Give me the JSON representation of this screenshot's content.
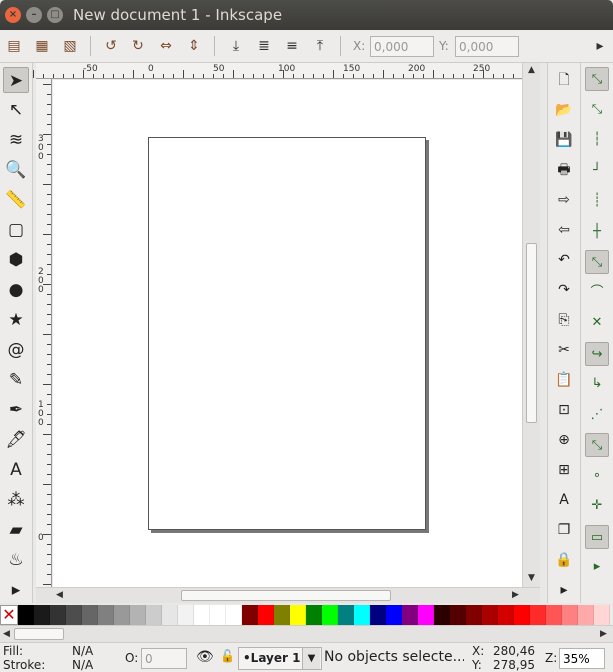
{
  "window": {
    "title": "New document 1 - Inkscape",
    "close_glyph": "×",
    "min_glyph": "–",
    "max_glyph": "□"
  },
  "ctrlbar": {
    "icons": [
      "select-all-icon",
      "select-all-layers-icon",
      "deselect-icon",
      "rotate-ccw-icon",
      "rotate-cw-icon",
      "flip-horizontal-icon",
      "flip-vertical-icon",
      "lower-bottom-icon",
      "lower-icon",
      "raise-icon",
      "raise-top-icon"
    ],
    "x_label": "X:",
    "x_value": "0,000",
    "y_label": "Y:",
    "y_value": "0,000",
    "more": "▸"
  },
  "tools": [
    {
      "name": "selector-tool-icon",
      "glyph": "➤"
    },
    {
      "name": "node-tool-icon",
      "glyph": "↖"
    },
    {
      "name": "tweak-tool-icon",
      "glyph": "≋"
    },
    {
      "name": "zoom-tool-icon",
      "glyph": "🔍"
    },
    {
      "name": "measure-tool-icon",
      "glyph": "📏"
    },
    {
      "name": "rectangle-tool-icon",
      "glyph": "▢"
    },
    {
      "name": "box-3d-tool-icon",
      "glyph": "⬢"
    },
    {
      "name": "ellipse-tool-icon",
      "glyph": "●"
    },
    {
      "name": "star-tool-icon",
      "glyph": "★"
    },
    {
      "name": "spiral-tool-icon",
      "glyph": "@"
    },
    {
      "name": "pencil-tool-icon",
      "glyph": "✎"
    },
    {
      "name": "pen-tool-icon",
      "glyph": "✒"
    },
    {
      "name": "calligraphy-tool-icon",
      "glyph": "🖋"
    },
    {
      "name": "text-tool-icon",
      "glyph": "A"
    },
    {
      "name": "spray-tool-icon",
      "glyph": "⁂"
    },
    {
      "name": "eraser-tool-icon",
      "glyph": "▰"
    },
    {
      "name": "paint-bucket-tool-icon",
      "glyph": "♨"
    },
    {
      "name": "more-tools-icon",
      "glyph": "▸"
    }
  ],
  "ruler": {
    "top": [
      "-50",
      "0",
      "50",
      "100",
      "150",
      "200",
      "250"
    ],
    "left": [
      "3\n0\n0",
      "2\n0\n0",
      "1\n0\n0",
      "0"
    ]
  },
  "commands": [
    {
      "name": "new-document-icon",
      "glyph": "🗋"
    },
    {
      "name": "open-document-icon",
      "glyph": "📂"
    },
    {
      "name": "save-document-icon",
      "glyph": "💾"
    },
    {
      "name": "print-icon",
      "glyph": "🖶"
    },
    {
      "name": "import-icon",
      "glyph": "⇨"
    },
    {
      "name": "export-icon",
      "glyph": "⇦"
    },
    {
      "name": "undo-icon",
      "glyph": "↶"
    },
    {
      "name": "redo-icon",
      "glyph": "↷"
    },
    {
      "name": "copy-icon",
      "glyph": "⎘"
    },
    {
      "name": "cut-icon",
      "glyph": "✂"
    },
    {
      "name": "paste-icon",
      "glyph": "📋"
    },
    {
      "name": "zoom-selection-icon",
      "glyph": "⊡"
    },
    {
      "name": "zoom-drawing-icon",
      "glyph": "⊕"
    },
    {
      "name": "zoom-page-icon",
      "glyph": "⊞"
    },
    {
      "name": "text-font-icon",
      "glyph": "A"
    },
    {
      "name": "group-icon",
      "glyph": "❐"
    },
    {
      "name": "ungroup-icon",
      "glyph": "🔒"
    },
    {
      "name": "more-commands-icon",
      "glyph": "▸"
    }
  ],
  "snaps": [
    {
      "name": "snap-enable-icon",
      "glyph": "⤡",
      "on": true
    },
    {
      "name": "snap-bbox-icon",
      "glyph": "⤡",
      "on": false
    },
    {
      "name": "snap-bbox-edge-icon",
      "glyph": "┆",
      "on": false
    },
    {
      "name": "snap-bbox-corner-icon",
      "glyph": "┘",
      "on": false
    },
    {
      "name": "snap-bbox-midpoint-icon",
      "glyph": "┊",
      "on": false
    },
    {
      "name": "snap-bbox-center-icon",
      "glyph": "┼",
      "on": false
    },
    {
      "name": "snap-nodes-icon",
      "glyph": "⤡",
      "on": true
    },
    {
      "name": "snap-path-icon",
      "glyph": "⌒",
      "on": false
    },
    {
      "name": "snap-intersection-icon",
      "glyph": "✕",
      "on": false
    },
    {
      "name": "snap-smooth-icon",
      "glyph": "↪",
      "on": true
    },
    {
      "name": "snap-midpoint-icon",
      "glyph": "↳",
      "on": false
    },
    {
      "name": "snap-line-icon",
      "glyph": "⋰",
      "on": false
    },
    {
      "name": "snap-others-icon",
      "glyph": "⤡",
      "on": true
    },
    {
      "name": "snap-center-icon",
      "glyph": "∘",
      "on": false
    },
    {
      "name": "snap-rotation-icon",
      "glyph": "✛",
      "on": false
    },
    {
      "name": "snap-page-icon",
      "glyph": "▭",
      "on": true
    },
    {
      "name": "snap-grid-icon",
      "glyph": "▸",
      "on": false
    }
  ],
  "palette": [
    "#000000",
    "#1a1a1a",
    "#333333",
    "#4d4d4d",
    "#666666",
    "#808080",
    "#999999",
    "#b3b3b3",
    "#cccccc",
    "#e6e6e6",
    "#f2f2f2",
    "#ffffff",
    "#ffffff",
    "#ffffff",
    "#800000",
    "#ff0000",
    "#808000",
    "#ffff00",
    "#008000",
    "#00ff00",
    "#008080",
    "#00ffff",
    "#000080",
    "#0000ff",
    "#800080",
    "#ff00ff",
    "#2b0000",
    "#550000",
    "#800000",
    "#aa0000",
    "#d40000",
    "#ff0000",
    "#ff2a2a",
    "#ff5555",
    "#ff8080",
    "#ffaaaa",
    "#ffd5d5"
  ],
  "status": {
    "fill_label": "Fill:",
    "fill_value": "N/A",
    "stroke_label": "Stroke:",
    "stroke_value": "N/A",
    "opacity_label": "O:",
    "opacity_value": "0",
    "layer": "•Layer 1",
    "layer_arrow": "▼",
    "message": "No objects selecte...",
    "x_label": "X:",
    "x_value": "280,46",
    "y_label": "Y:",
    "y_value": "278,95",
    "zoom_label": "Z:",
    "zoom_value": "35%"
  }
}
